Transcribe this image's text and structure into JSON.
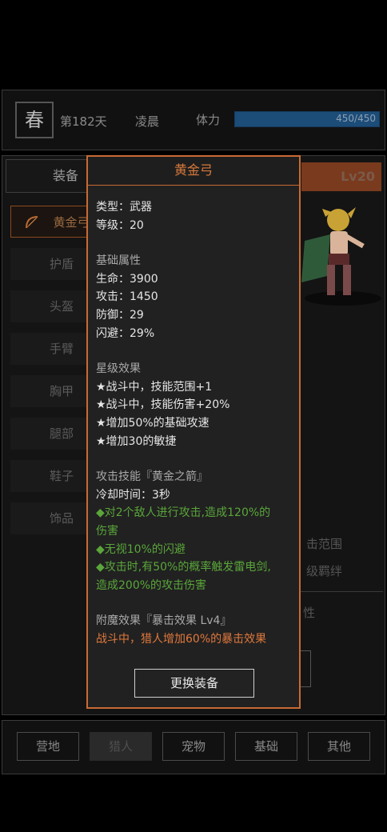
{
  "status": {
    "season": "春",
    "day": "第182天",
    "time_of_day": "凌晨",
    "stamina_label": "体力",
    "stamina_text": "450/450",
    "stamina_fraction": 1.0
  },
  "panel": {
    "equip_tab": "装备",
    "level_tab": "Lv20",
    "slots": [
      "黄金弓",
      "护盾",
      "头盔",
      "手臂",
      "胸甲",
      "腿部",
      "鞋子",
      "饰品"
    ],
    "faded_right_1": "击范围",
    "faded_right_2": "级羁绊",
    "faded_right_3": "性"
  },
  "popup": {
    "title": "黄金弓",
    "type_line": "类型：武器",
    "level_line": "等级：20",
    "base_head": "基础属性",
    "hp": "生命：3900",
    "atk": "攻击：1450",
    "def": "防御：29",
    "dodge": "闪避：29%",
    "star_head": "星级效果",
    "star1": "★战斗中，技能范围+1",
    "star2": "★战斗中，技能伤害+20%",
    "star3": "★增加50%的基础攻速",
    "star4": "★增加30的敏捷",
    "skill_head": "攻击技能『黄金之箭』",
    "cooldown": "冷却时间：3秒",
    "skill1a": "◆对2个敌人进行攻击,造成120%的",
    "skill1b": "伤害",
    "skill2": "◆无视10%的闪避",
    "skill3a": "◆攻击时,有50%的概率触发雷电剑,",
    "skill3b": "造成200%的攻击伤害",
    "enchant_head": "附魔效果『暴击效果 Lv4』",
    "enchant_desc": "战斗中，猎人增加60%的暴击效果",
    "swap_button": "更换装备"
  },
  "nav": [
    "营地",
    "猎人",
    "宠物",
    "基础",
    "其他"
  ],
  "colors": {
    "accent_orange": "#c86a34",
    "skill_green": "#5aa63a",
    "enchant_orange": "#e0783c",
    "stamina_blue": "#1c4c78"
  }
}
